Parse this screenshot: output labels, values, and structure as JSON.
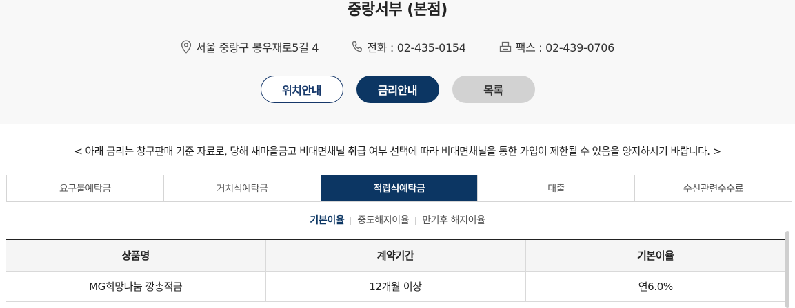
{
  "branch": {
    "title": "중랑서부 (본점)",
    "address": "서울 중랑구 봉우재로5길 4",
    "phone": "전화 : 02-435-0154",
    "fax": "팩스 : 02-439-0706"
  },
  "buttons": {
    "location": "위치안내",
    "rates": "금리안내",
    "list": "목록"
  },
  "notice": "< 아래 금리는 창구판매 기준 자료로, 당해 새마을금고 비대면채널 취급 여부 선택에 따라 비대면채널을 통한 가입이 제한될 수 있음을 양지하시기 바랍니다. >",
  "tabs": [
    {
      "label": "요구불예탁금",
      "active": false
    },
    {
      "label": "거치식예탁금",
      "active": false
    },
    {
      "label": "적립식예탁금",
      "active": true
    },
    {
      "label": "대출",
      "active": false
    },
    {
      "label": "수신관련수수료",
      "active": false
    }
  ],
  "subtabs": [
    {
      "label": "기본이율",
      "active": true
    },
    {
      "label": "중도해지이율",
      "active": false
    },
    {
      "label": "만기후 해지이율",
      "active": false
    }
  ],
  "table": {
    "headers": [
      "상품명",
      "계약기간",
      "기본이율"
    ],
    "rows": [
      [
        "MG희망나눔 깡총적금",
        "12개월 이상",
        "연6.0%"
      ]
    ]
  },
  "colors": {
    "primary": "#0c3663",
    "top_background": "#f8f8f8",
    "gray_button": "#d2d2d2"
  },
  "icons": {
    "address": "map-pin-icon",
    "phone": "phone-icon",
    "fax": "fax-icon"
  }
}
